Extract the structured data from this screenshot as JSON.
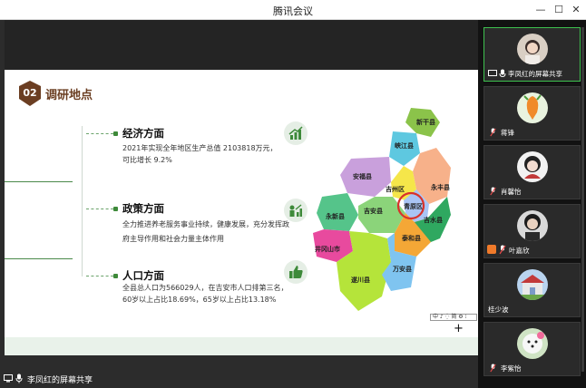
{
  "window": {
    "title": "腾讯会议",
    "controls": [
      "minimize-icon",
      "restore-icon",
      "close-icon"
    ]
  },
  "slide": {
    "number": "02",
    "title": "调研地点",
    "sections": [
      {
        "heading": "经济方面",
        "lines": [
          "2021年实现全年地区生产总值 2103818万元，",
          "可比增长 9.2%"
        ],
        "icon": "growth-chart-icon"
      },
      {
        "heading": "政策方面",
        "lines": [
          "全力推进养老服务事业持续，健康发展，充分发挥政",
          "府主导作用和社会力量主体作用"
        ],
        "icon": "people-growth-icon"
      },
      {
        "heading": "人口方面",
        "lines": [
          "全县总人口为566029人，在吉安市人口排第三名，",
          "60岁以上占比18.69%，65岁以上占比13.18%"
        ],
        "icon": "thumbs-up-icon"
      }
    ],
    "map_labels": [
      "新干县",
      "峡江县",
      "安福县",
      "吉州区",
      "青原区",
      "永丰县",
      "永新县",
      "吉安县",
      "泰和县",
      "井冈山市",
      "遂川县",
      "万安县",
      "吉水县"
    ],
    "highlight_color": "#d9322b"
  },
  "toolstrip": {
    "text": "中 ♪ ⁛ 简 ⚙ ⁝"
  },
  "sharebar": {
    "label": "李凤红的屏幕共享"
  },
  "participants": [
    {
      "name": "李凤红的屏幕共享",
      "active": true,
      "screen_share": true
    },
    {
      "name": "蒋锋",
      "active": false,
      "screen_share": false
    },
    {
      "name": "肖馨怡",
      "active": false,
      "screen_share": false
    },
    {
      "name": "叶嘉欣",
      "active": false,
      "screen_share": false,
      "host": true
    },
    {
      "name": "桂少波",
      "active": false,
      "screen_share": false
    },
    {
      "name": "李紫怡",
      "active": false,
      "screen_share": false
    }
  ],
  "colors": {
    "accent_green": "#3e8a3a",
    "title_brown": "#6b3e22",
    "active_border": "#3ec14f"
  }
}
